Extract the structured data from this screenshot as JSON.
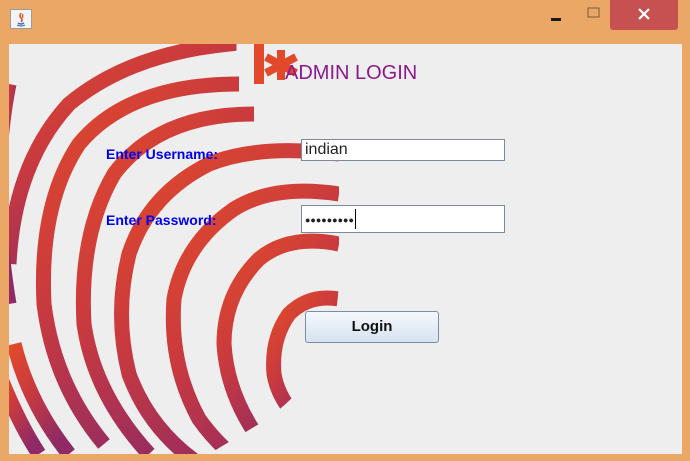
{
  "window": {
    "titlebar_color": "#eba765",
    "close_color": "#c75050",
    "icons": [
      "java-app-icon",
      "minimize-icon",
      "maximize-icon",
      "close-icon"
    ]
  },
  "form": {
    "heading": "ADMIN LOGIN",
    "username_label": "Enter Username:",
    "username_value": "indian",
    "password_label": "Enter Password:",
    "password_mask": "●●●●●●●●●",
    "login_label": "Login"
  },
  "colors": {
    "label": "#0000ee",
    "heading": "#8a1a8c",
    "logo_orange": "#e2492a",
    "logo_purple": "#9b2a64"
  }
}
